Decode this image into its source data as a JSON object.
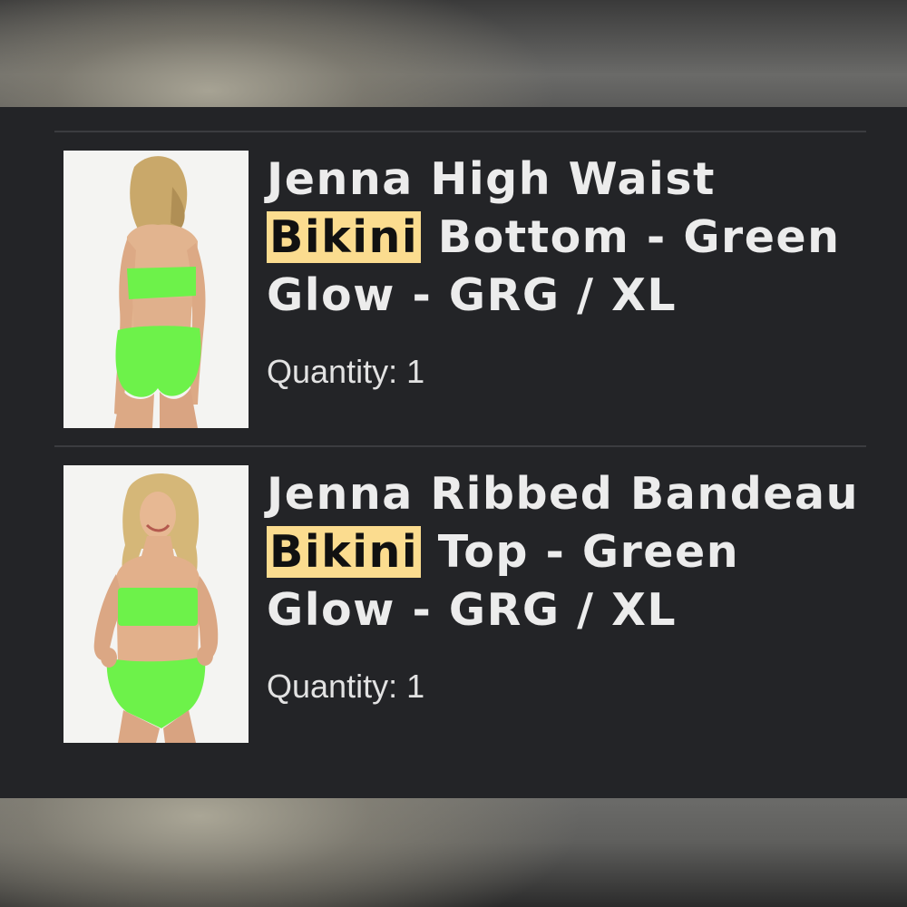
{
  "items": [
    {
      "title_before": "Jenna High Waist ",
      "title_highlight": "Bikini",
      "title_after": " Bottom - Green Glow - GRG / XL",
      "quantity_label": "Quantity:",
      "quantity_value": "1",
      "image_alt": "model wearing green high waist bikini, back view"
    },
    {
      "title_before": "Jenna Ribbed Bandeau ",
      "title_highlight": "Bikini",
      "title_after": " Top - Green Glow - GRG / XL",
      "quantity_label": "Quantity:",
      "quantity_value": "1",
      "image_alt": "model wearing green bandeau bikini, front view"
    }
  ],
  "colors": {
    "panel": "#232427",
    "highlight": "#fbdc8f",
    "swimsuit": "#6df24a",
    "text": "#ececec"
  }
}
